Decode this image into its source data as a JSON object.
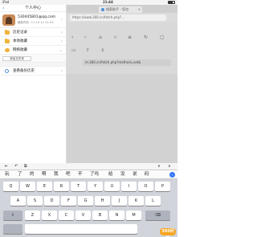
{
  "status_bar": {
    "carrier": "iPad",
    "time": "21:44"
  },
  "browser": {
    "tab_title": "搜索助手 - 您也",
    "url": "https://www.360.cn/fetch.php?...",
    "url2": "m.360.cn/fetch.php?method=set&"
  },
  "panel": {
    "title": "个人中心",
    "back_icon": "chevron-left-icon",
    "user": {
      "email": "530445801@qq.com",
      "sync_time": "最新同步: 17-10-11 21:43"
    },
    "items": [
      {
        "label": "历史记录",
        "icon": "folder-icon"
      },
      {
        "label": "本地收藏",
        "icon": "folder-icon"
      },
      {
        "label": "网络收藏",
        "icon": "cloud-icon"
      }
    ],
    "add_folder_label": "添加文件夹",
    "history_backup_label": "查看备份历史"
  },
  "keyboard": {
    "toolbar": [
      "⇤",
      "↶",
      "⧉"
    ],
    "toolbar_right": [
      "∨",
      "∧"
    ],
    "candidates": [
      "玩",
      "了",
      "的",
      "啊",
      "我",
      "吧",
      "不",
      "了吗",
      "给",
      "没",
      "说",
      "码"
    ],
    "expand": "›",
    "rows": [
      [
        "Q",
        "W",
        "E",
        "R",
        "T",
        "Y",
        "U",
        "I",
        "O",
        "P"
      ],
      [
        "A",
        "S",
        "D",
        "F",
        "G",
        "H",
        "J",
        "K",
        "L"
      ],
      [
        "⇧",
        "Z",
        "X",
        "C",
        "V",
        "B",
        "N",
        "M",
        "⌫"
      ]
    ]
  },
  "watermark": "360问答"
}
